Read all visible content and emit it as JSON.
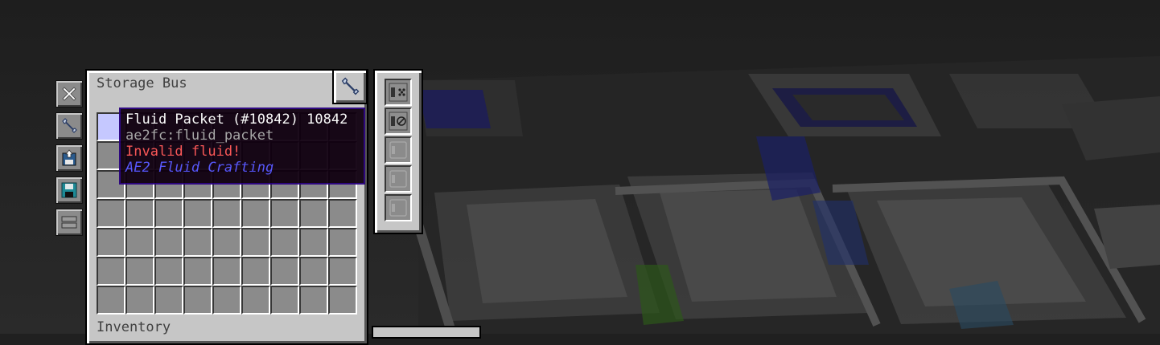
{
  "panel": {
    "title": "Storage Bus",
    "inventory_label": "Inventory"
  },
  "side_buttons": [
    {
      "name": "close-button",
      "icon": "close-icon"
    },
    {
      "name": "wrench-button",
      "icon": "wrench-icon"
    },
    {
      "name": "partition-button",
      "icon": "disk-upload-icon"
    },
    {
      "name": "save-button",
      "icon": "floppy-disk-icon"
    },
    {
      "name": "view-mode-button",
      "icon": "layers-icon"
    }
  ],
  "upgrades": {
    "slots": [
      {
        "icon": "fuzzy-card-icon"
      },
      {
        "icon": "inverter-card-icon"
      },
      {
        "icon": "empty-upgrade-icon"
      },
      {
        "icon": "empty-upgrade-icon"
      },
      {
        "icon": "empty-upgrade-icon"
      }
    ]
  },
  "tooltip": {
    "title": "Fluid Packet (#10842) 10842",
    "registry_id": "ae2fc:fluid_packet",
    "warning": "Invalid fluid!",
    "mod_name": "AE2 Fluid Crafting"
  },
  "colors": {
    "panel_bg": "#c6c6c6",
    "slot_bg": "#8b8b8b",
    "hover_slot": "#c5c8ff",
    "tooltip_bg": "#100010",
    "tooltip_border": "#28007f",
    "warning": "#ff5555",
    "mod_name": "#5555ff"
  }
}
